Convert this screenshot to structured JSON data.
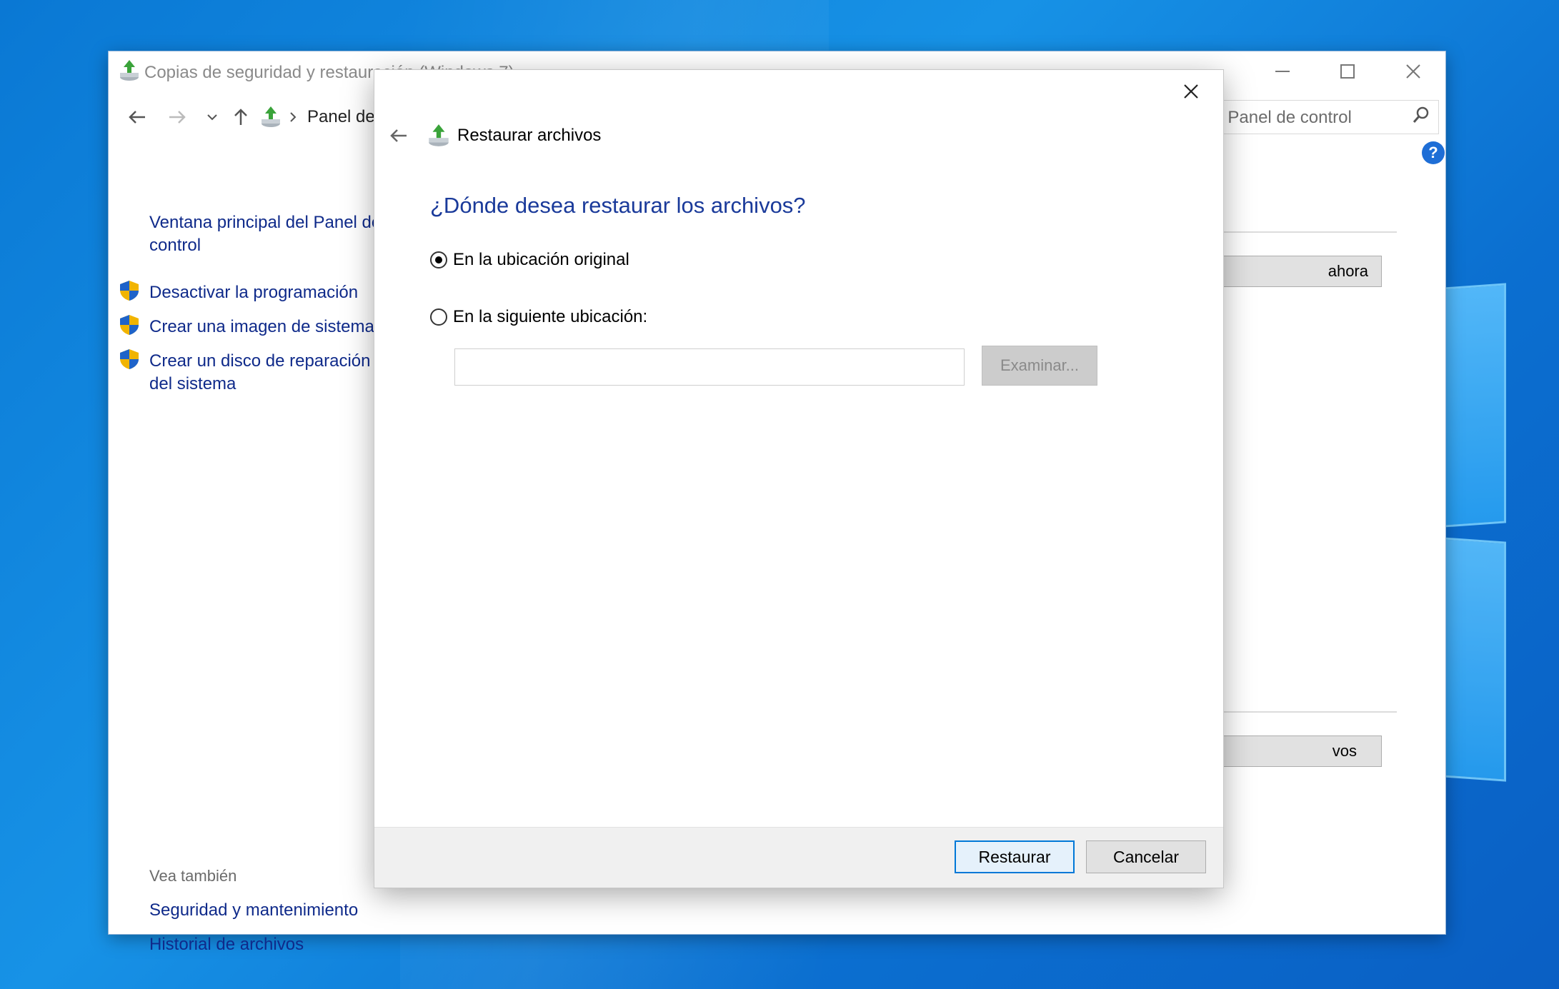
{
  "window": {
    "title": "Copias de seguridad y restauración (Windows 7)",
    "address": "Panel de",
    "search_placeholder": "n el Panel de control",
    "help": "?"
  },
  "left_pane": {
    "home_link_line1": "Ventana principal del Panel de",
    "home_link_line2": "control",
    "tasks": [
      {
        "label": "Desactivar la programación"
      },
      {
        "label": "Crear una imagen de sistema"
      },
      {
        "label_line1": "Crear un disco de reparación",
        "label_line2": "del sistema"
      }
    ],
    "see_also_label": "Vea también",
    "see_also": [
      {
        "label": "Seguridad y mantenimiento"
      },
      {
        "label": "Historial de archivos"
      }
    ]
  },
  "background_buttons": {
    "backup_now_partial": "ahora",
    "restore_partial": "vos"
  },
  "dialog": {
    "title": "Restaurar archivos",
    "question": "¿Dónde desea restaurar los archivos?",
    "options": [
      {
        "label": "En la ubicación original",
        "checked": true
      },
      {
        "label": "En la siguiente ubicación:",
        "checked": false
      }
    ],
    "path_value": "",
    "browse_label": "Examinar...",
    "restore_label": "Restaurar",
    "cancel_label": "Cancelar"
  },
  "colors": {
    "link": "#0f2a8a",
    "heading": "#1a3a9a",
    "primary_border": "#0078d7",
    "desktop": "#0a78d4"
  }
}
